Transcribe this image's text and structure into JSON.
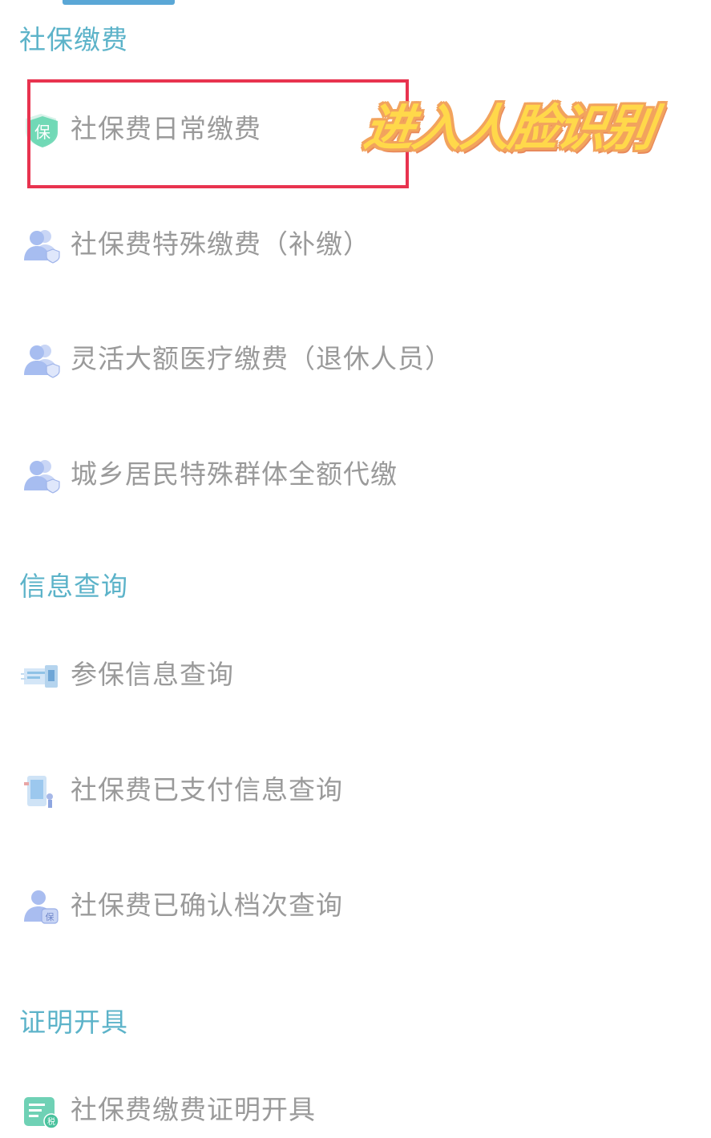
{
  "sections": [
    {
      "title": "社保缴费",
      "items": [
        {
          "label": "社保费日常缴费",
          "icon": "shield-bao-icon"
        },
        {
          "label": "社保费特殊缴费（补缴）",
          "icon": "people-shield-icon"
        },
        {
          "label": "灵活大额医疗缴费（退休人员）",
          "icon": "people-shield-icon"
        },
        {
          "label": "城乡居民特殊群体全额代缴",
          "icon": "people-shield-icon"
        }
      ]
    },
    {
      "title": "信息查询",
      "items": [
        {
          "label": "参保信息查询",
          "icon": "document-scan-icon"
        },
        {
          "label": "社保费已支付信息查询",
          "icon": "phone-payment-icon"
        },
        {
          "label": "社保费已确认档次查询",
          "icon": "person-badge-icon"
        }
      ]
    },
    {
      "title": "证明开具",
      "items": [
        {
          "label": "社保费缴费证明开具",
          "icon": "tax-certificate-icon"
        }
      ]
    }
  ],
  "annotation": {
    "text": "进入人脸识别",
    "highlight_color": "#e8334f"
  },
  "colors": {
    "section_title": "#5cb3c9",
    "item_text": "#9a9a9a",
    "tab_indicator": "#5aa7d6",
    "annotation_fill": "#ffd84a",
    "annotation_outline": "#f2a35d"
  },
  "icon_glyphs": {
    "shield_bao": "保",
    "tax": "税",
    "badge": "保"
  }
}
